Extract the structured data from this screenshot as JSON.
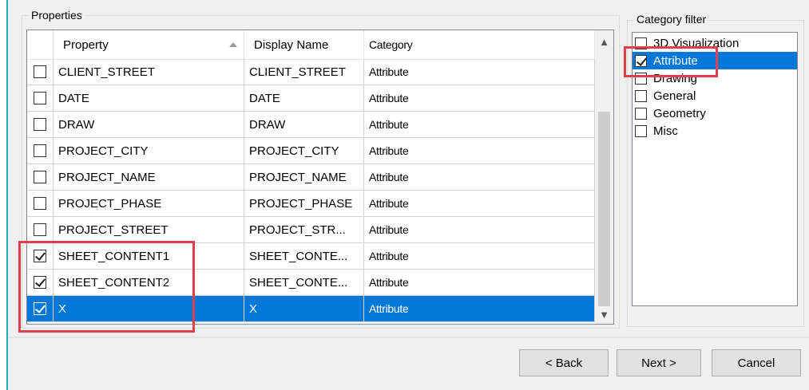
{
  "properties_group": {
    "title": "Properties",
    "columns": [
      "Property",
      "Display Name",
      "Category"
    ],
    "rows": [
      {
        "checked": false,
        "property": "CLIENT_STREET",
        "display_name": "CLIENT_STREET",
        "category": "Attribute",
        "selected": false
      },
      {
        "checked": false,
        "property": "DATE",
        "display_name": "DATE",
        "category": "Attribute",
        "selected": false
      },
      {
        "checked": false,
        "property": "DRAW",
        "display_name": "DRAW",
        "category": "Attribute",
        "selected": false
      },
      {
        "checked": false,
        "property": "PROJECT_CITY",
        "display_name": "PROJECT_CITY",
        "category": "Attribute",
        "selected": false
      },
      {
        "checked": false,
        "property": "PROJECT_NAME",
        "display_name": "PROJECT_NAME",
        "category": "Attribute",
        "selected": false
      },
      {
        "checked": false,
        "property": "PROJECT_PHASE",
        "display_name": "PROJECT_PHASE",
        "category": "Attribute",
        "selected": false
      },
      {
        "checked": false,
        "property": "PROJECT_STREET",
        "display_name": "PROJECT_STR...",
        "category": "Attribute",
        "selected": false
      },
      {
        "checked": true,
        "property": "SHEET_CONTENT1",
        "display_name": "SHEET_CONTE...",
        "category": "Attribute",
        "selected": false
      },
      {
        "checked": true,
        "property": "SHEET_CONTENT2",
        "display_name": "SHEET_CONTE...",
        "category": "Attribute",
        "selected": false
      },
      {
        "checked": true,
        "property": "X",
        "display_name": "X",
        "category": "Attribute",
        "selected": true
      }
    ],
    "scroll_up_icon": "chevron-up-icon",
    "scroll_down_icon": "chevron-down-icon"
  },
  "category_filter": {
    "title": "Category filter",
    "items": [
      {
        "label": "3D Visualization",
        "checked": false,
        "selected": false
      },
      {
        "label": "Attribute",
        "checked": true,
        "selected": true
      },
      {
        "label": "Drawing",
        "checked": false,
        "selected": false
      },
      {
        "label": "General",
        "checked": false,
        "selected": false
      },
      {
        "label": "Geometry",
        "checked": false,
        "selected": false
      },
      {
        "label": "Misc",
        "checked": false,
        "selected": false
      }
    ]
  },
  "buttons": {
    "back": "< Back",
    "next": "Next >",
    "cancel": "Cancel"
  },
  "colors": {
    "selection": "#0078d7",
    "highlight": "#e0404b"
  }
}
